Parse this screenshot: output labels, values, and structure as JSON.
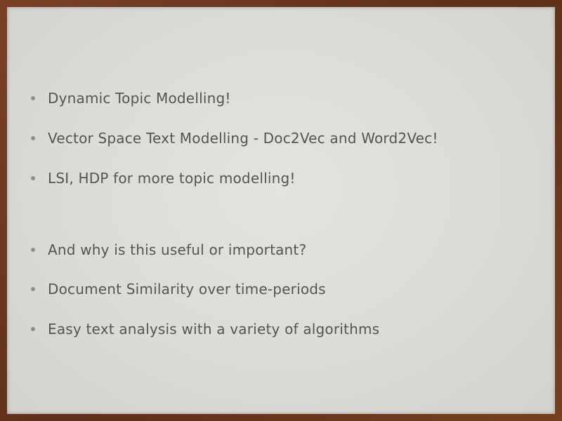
{
  "slide": {
    "bullets": [
      "Dynamic Topic Modelling!",
      "Vector Space Text Modelling - Doc2Vec and Word2Vec!",
      "LSI, HDP for more topic modelling!",
      "And why is this useful or important?",
      "Document Similarity over time-periods",
      "Easy text analysis with a variety of algorithms"
    ]
  },
  "colors": {
    "frame": "#6b3a22",
    "slide_background": "#dcdbd8",
    "text": "#555452",
    "bullet": "#8f8e8b"
  }
}
